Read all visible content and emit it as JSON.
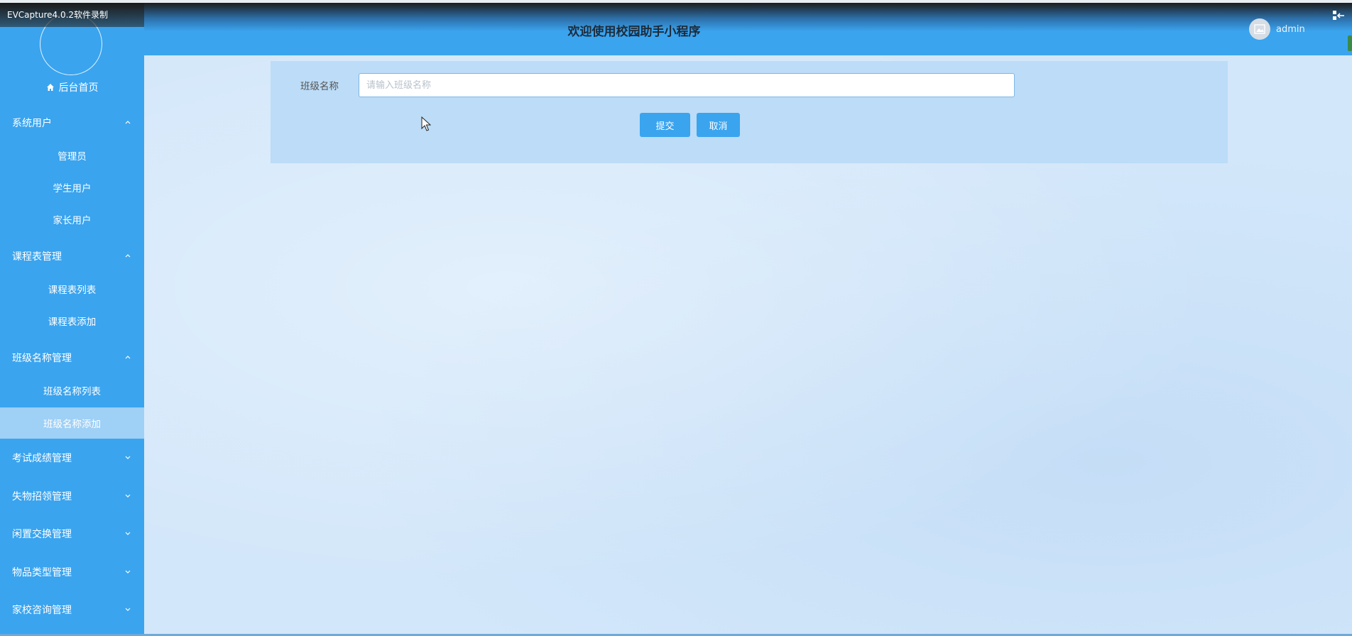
{
  "recorder": {
    "label": "EVCapture4.0.2软件录制"
  },
  "header": {
    "title": "欢迎使用校园助手小程序",
    "username": "admin"
  },
  "sidebar": {
    "home": "后台首页",
    "groups": [
      {
        "label": "系统用户",
        "expanded": true,
        "items": [
          "管理员",
          "学生用户",
          "家长用户"
        ]
      },
      {
        "label": "课程表管理",
        "expanded": true,
        "items": [
          "课程表列表",
          "课程表添加"
        ]
      },
      {
        "label": "班级名称管理",
        "expanded": true,
        "items": [
          "班级名称列表",
          "班级名称添加"
        ],
        "active_item": "班级名称添加"
      },
      {
        "label": "考试成绩管理",
        "expanded": false
      },
      {
        "label": "失物招领管理",
        "expanded": false
      },
      {
        "label": "闲置交换管理",
        "expanded": false
      },
      {
        "label": "物品类型管理",
        "expanded": false
      },
      {
        "label": "家校咨询管理",
        "expanded": false
      }
    ]
  },
  "form": {
    "field_label": "班级名称",
    "field_placeholder": "请输入班级名称",
    "field_value": "",
    "submit_label": "提交",
    "cancel_label": "取消"
  },
  "colors": {
    "primary": "#3aa4ef",
    "active_item_bg": "#9fd0f6",
    "main_bg": "#d3e7fa",
    "panel_bg": "#bcdcf7"
  }
}
